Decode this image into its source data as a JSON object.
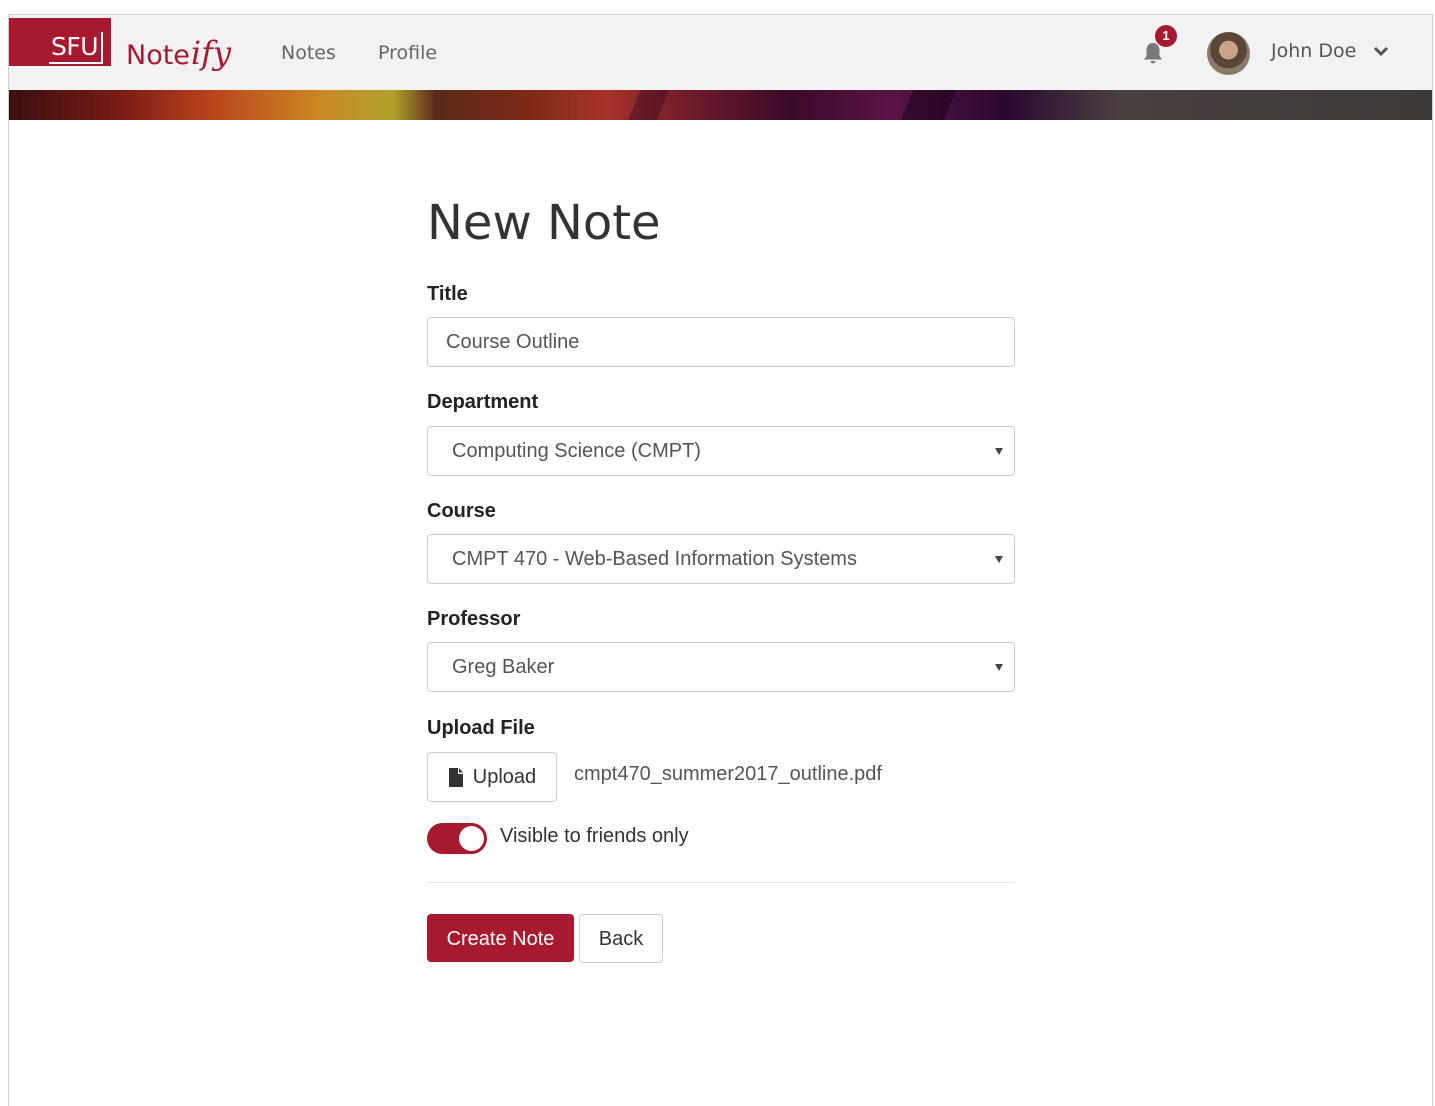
{
  "navbar": {
    "brand_sfu": "SFU",
    "brand_name": "Note",
    "brand_script": "ify",
    "links": [
      "Notes",
      "Profile"
    ],
    "notification_count": "1",
    "notification_icon": "bell-icon",
    "user_name": "John Doe",
    "user_chevron_icon": "chevron-down-icon"
  },
  "colors": {
    "accent": "#a6192e",
    "navbar_bg": "#f2f2f2"
  },
  "form": {
    "title": "New Note",
    "fields": {
      "title": {
        "label": "Title",
        "value": "Course Outline"
      },
      "department": {
        "label": "Department",
        "value": "Computing Science (CMPT)"
      },
      "course": {
        "label": "Course",
        "value": "CMPT 470 - Web-Based Information Systems"
      },
      "professor": {
        "label": "Professor",
        "value": "Greg Baker"
      }
    },
    "upload": {
      "label": "Upload File",
      "button_label": "Upload",
      "button_icon": "file-icon",
      "file_name": "cmpt470_summer2017_outline.pdf"
    },
    "visibility": {
      "label": "Visible to friends only",
      "on": true
    },
    "actions": {
      "submit": "Create Note",
      "back": "Back"
    }
  }
}
